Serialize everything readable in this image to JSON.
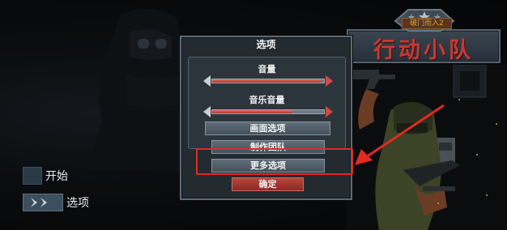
{
  "game": {
    "title_main": "行动小队",
    "title_sub": "破门而入2"
  },
  "main_menu": {
    "items": [
      {
        "label": "开始",
        "active": false
      },
      {
        "label": "选项",
        "active": true
      }
    ]
  },
  "options_dialog": {
    "title": "选项",
    "volume": {
      "label": "音量",
      "level": 0.97
    },
    "music_volume": {
      "label": "音乐音量",
      "level": 0.72
    },
    "buttons": {
      "graphics": "画面选项",
      "credits": "制作团队",
      "more": "更多选项",
      "confirm": "确定"
    }
  },
  "colors": {
    "annotation": "#e02a22",
    "title_red": "#c63a34",
    "confirm_red": "#b8463c"
  }
}
